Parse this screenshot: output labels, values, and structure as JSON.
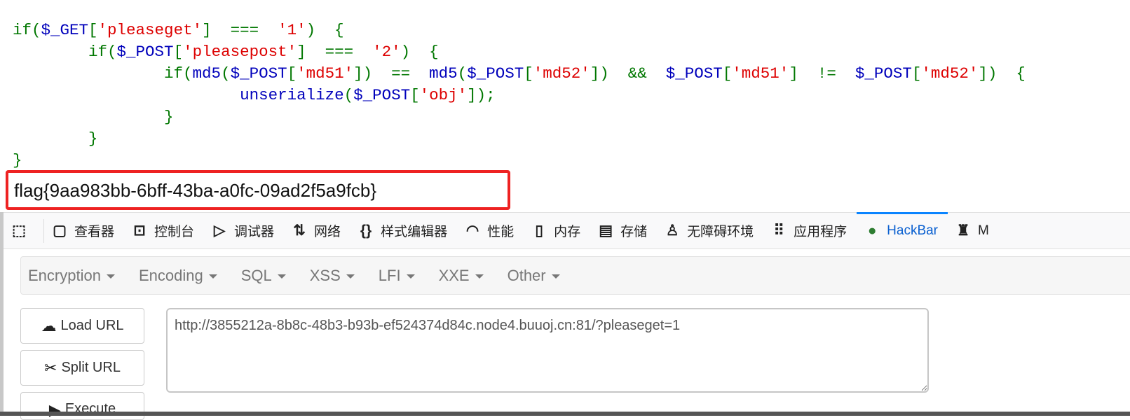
{
  "code": {
    "l1": [
      [
        "k",
        "if("
      ],
      [
        "v",
        "$_GET"
      ],
      [
        "k",
        "["
      ],
      [
        "s",
        "'pleaseget'"
      ],
      [
        "k",
        "]&nbsp;&nbsp;===&nbsp;&nbsp;"
      ],
      [
        "s",
        "'1'"
      ],
      [
        "k",
        ")&nbsp;&nbsp;{"
      ]
    ],
    "lines": [
      [
        [
          "k",
          "if("
        ],
        [
          "v",
          "$_GET"
        ],
        [
          "k",
          "["
        ],
        [
          "s",
          "'pleaseget'"
        ],
        [
          "k",
          "]  ===  "
        ],
        [
          "s",
          "'1'"
        ],
        [
          "k",
          ")  {"
        ]
      ],
      [
        [
          "k",
          "        if("
        ],
        [
          "v",
          "$_POST"
        ],
        [
          "k",
          "["
        ],
        [
          "s",
          "'pleasepost'"
        ],
        [
          "k",
          "]  ===  "
        ],
        [
          "s",
          "'2'"
        ],
        [
          "k",
          ")  {"
        ]
      ],
      [
        [
          "k",
          "                if("
        ],
        [
          "v",
          "md5"
        ],
        [
          "k",
          "("
        ],
        [
          "v",
          "$_POST"
        ],
        [
          "k",
          "["
        ],
        [
          "s",
          "'md51'"
        ],
        [
          "k",
          "])  ==  "
        ],
        [
          "v",
          "md5"
        ],
        [
          "k",
          "("
        ],
        [
          "v",
          "$_POST"
        ],
        [
          "k",
          "["
        ],
        [
          "s",
          "'md52'"
        ],
        [
          "k",
          "])  &&  "
        ],
        [
          "v",
          "$_POST"
        ],
        [
          "k",
          "["
        ],
        [
          "s",
          "'md51'"
        ],
        [
          "k",
          "]  !=  "
        ],
        [
          "v",
          "$_POST"
        ],
        [
          "k",
          "["
        ],
        [
          "s",
          "'md52'"
        ],
        [
          "k",
          "])  {"
        ]
      ],
      [
        [
          "k",
          "                        "
        ],
        [
          "v",
          "unserialize"
        ],
        [
          "k",
          "("
        ],
        [
          "v",
          "$_POST"
        ],
        [
          "k",
          "["
        ],
        [
          "s",
          "'obj'"
        ],
        [
          "k",
          "]);"
        ]
      ],
      [
        [
          "k",
          "                }"
        ]
      ],
      [
        [
          "k",
          "        }"
        ]
      ],
      [
        [
          "k",
          "}"
        ]
      ]
    ]
  },
  "flag": "flag{9aa983bb-6bff-43ba-a0fc-09ad2f5a9fcb}",
  "devtools": {
    "tabs": [
      {
        "label": "",
        "icon": "pick-element-icon"
      },
      {
        "label": "查看器",
        "icon": "inspector-icon"
      },
      {
        "label": "控制台",
        "icon": "console-icon"
      },
      {
        "label": "调试器",
        "icon": "debugger-icon"
      },
      {
        "label": "网络",
        "icon": "network-icon"
      },
      {
        "label": "样式编辑器",
        "icon": "style-editor-icon"
      },
      {
        "label": "性能",
        "icon": "performance-icon"
      },
      {
        "label": "内存",
        "icon": "memory-icon"
      },
      {
        "label": "存储",
        "icon": "storage-icon"
      },
      {
        "label": "无障碍环境",
        "icon": "accessibility-icon"
      },
      {
        "label": "应用程序",
        "icon": "application-icon"
      },
      {
        "label": "HackBar",
        "icon": "hackbar-icon",
        "active": true
      },
      {
        "label": "M",
        "icon": "hacker-icon"
      }
    ]
  },
  "hackbar": {
    "menu": [
      "Encryption",
      "Encoding",
      "SQL",
      "XSS",
      "LFI",
      "XXE",
      "Other"
    ],
    "buttons": {
      "load": "Load URL",
      "split": "Split URL",
      "execute": "Execute"
    },
    "url": "http://3855212a-8b8c-48b3-b93b-ef524374d84c.node4.buuoj.cn:81/?pleaseget=1"
  },
  "colors": {
    "keyword": "#007700",
    "variable": "#0000BB",
    "string": "#DD0000",
    "highlight_box": "#ee2222",
    "active_tab": "#0a84ff"
  }
}
